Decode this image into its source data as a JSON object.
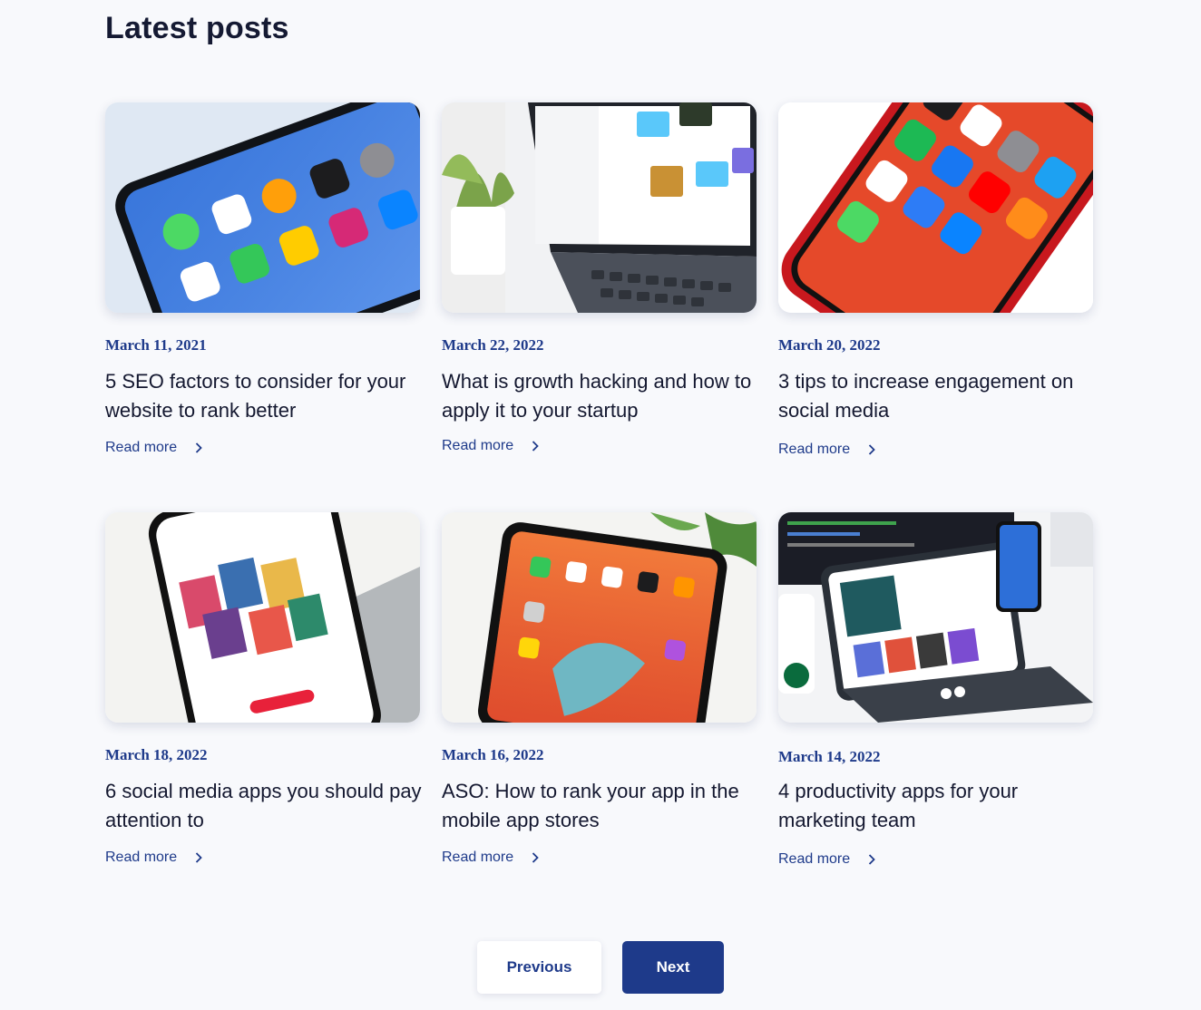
{
  "section": {
    "title": "Latest posts"
  },
  "posts": [
    {
      "date": "March 11, 2021",
      "title": "5 SEO factors to consider for your website to rank better",
      "cta": "Read more"
    },
    {
      "date": "March 22, 2022",
      "title": "What is growth hacking and how to apply it to your startup",
      "cta": "Read more"
    },
    {
      "date": "March 20, 2022",
      "title": "3 tips to increase engagement on social media",
      "cta": "Read more"
    },
    {
      "date": "March 18, 2022",
      "title": "6 social media apps you should pay attention to",
      "cta": "Read more"
    },
    {
      "date": "March 16, 2022",
      "title": "ASO: How to rank your app in the mobile app stores",
      "cta": "Read more"
    },
    {
      "date": "March 14, 2022",
      "title": "4 productivity apps for your marketing team",
      "cta": "Read more"
    }
  ],
  "pagination": {
    "previous": "Previous",
    "next": "Next"
  },
  "colors": {
    "accent": "#1e3a8a",
    "background": "#f8f9fc",
    "text": "#141830"
  }
}
